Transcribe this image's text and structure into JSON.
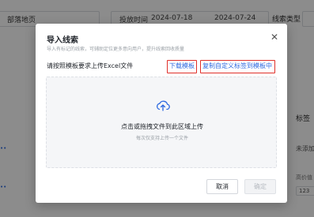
{
  "background": {
    "filter_select": "部落地页",
    "date_label": "投放时间",
    "date_start": "2024-07-18",
    "date_end": "2024-07-24",
    "type_label": "线索类型",
    "tag_header": "标签",
    "tag_value": "未添加",
    "tag_value2": "高价值",
    "tag_chip": "123"
  },
  "modal": {
    "title": "导入线索",
    "subtitle": "导入有标记的线索，可辅助定位更多意向用户，提升线索回收质量",
    "instruction": "请按照模板要求上传Excel文件",
    "download_link": "下载模板",
    "copy_link": "复制自定义标签到模板中",
    "dropzone": {
      "main_text": "点击或拖拽文件到此区域上传",
      "sub_text": "每次仅支持上传一个文件"
    },
    "cancel_label": "取消",
    "ok_label": "确定"
  },
  "colors": {
    "link": "#2f6ae0",
    "highlight_border": "#e0302a",
    "overlay": "rgba(0,0,0,0.45)"
  },
  "icons": {
    "close": "close-icon",
    "upload": "cloud-upload-icon"
  }
}
